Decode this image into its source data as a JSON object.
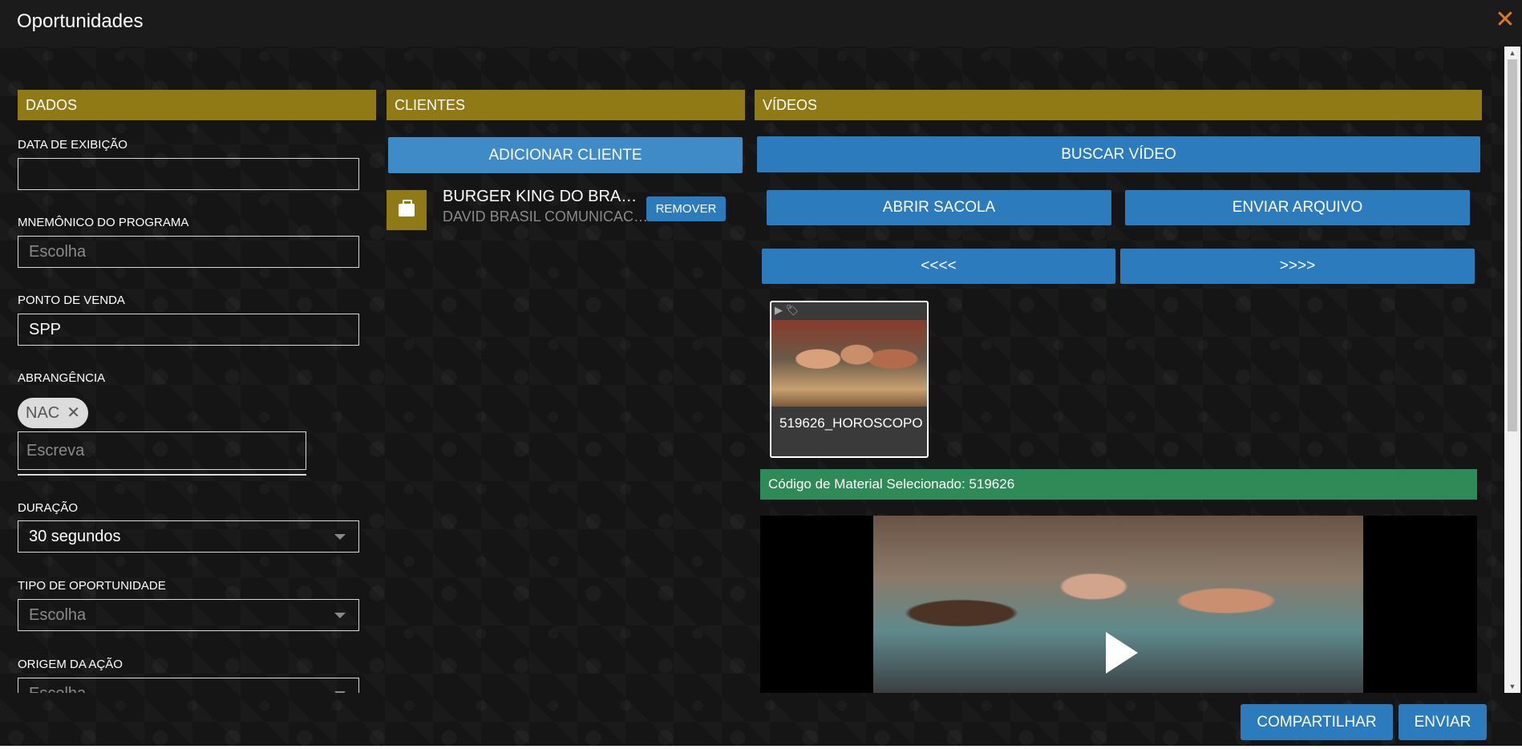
{
  "header": {
    "title": "Oportunidades",
    "close_glyph": "✕"
  },
  "sections": {
    "dados": "DADOS",
    "clientes": "CLIENTES",
    "videos": "VÍDEOS"
  },
  "form": {
    "data_exibicao": {
      "label": "DATA DE EXIBIÇÃO",
      "value": ""
    },
    "mnemonico": {
      "label": "MNEMÔNICO DO PROGRAMA",
      "placeholder": "Escolha"
    },
    "ponto_venda": {
      "label": "PONTO DE VENDA",
      "value": "SPP"
    },
    "abrangencia": {
      "label": "ABRANGÊNCIA",
      "chip": "NAC",
      "chip_remove": "✕",
      "placeholder": "Escreva"
    },
    "duracao": {
      "label": "DURAÇÃO",
      "value": "30 segundos"
    },
    "tipo_oportunidade": {
      "label": "TIPO DE OPORTUNIDADE",
      "placeholder": "Escolha"
    },
    "origem_acao": {
      "label": "ORIGEM DA AÇÃO",
      "placeholder": "Escolha"
    }
  },
  "clientes": {
    "add_button": "ADICIONAR CLIENTE",
    "items": [
      {
        "name": "BURGER KING DO BRA…",
        "agency": "DAVID BRASIL COMUNICAC…",
        "remove_label": "REMOVER",
        "icon": "briefcase-icon"
      }
    ]
  },
  "videos": {
    "search_button": "BUSCAR VÍDEO",
    "open_bag_button": "ABRIR SACOLA",
    "send_file_button": "ENVIAR ARQUIVO",
    "prev_button": "<<<<",
    "next_button": ">>>>",
    "thumbnails": [
      {
        "name": "519626_HOROSCOPO",
        "icons": "▶ 🏷"
      }
    ],
    "selected_text": "Código de Material Selecionado: 519626"
  },
  "footer": {
    "share_button": "COMPARTILHAR",
    "send_button": "ENVIAR"
  },
  "colors": {
    "section_header": "#8f7a16",
    "button": "#2b7bbd",
    "selected_bar": "#2e8a57",
    "close": "#e07a1f"
  }
}
